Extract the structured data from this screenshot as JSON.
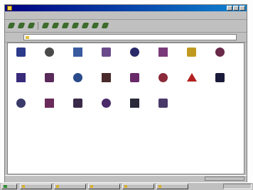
{
  "window": {
    "title": "",
    "icon": "folder-icon"
  },
  "menubar": {
    "items": [
      "",
      "",
      "",
      "",
      "",
      ""
    ]
  },
  "toolbar": {
    "buttons": [
      "back-icon",
      "forward-icon",
      "up-icon",
      "cut-icon",
      "copy-icon",
      "paste-icon",
      "undo-icon",
      "delete-icon",
      "properties-icon",
      "views-icon"
    ]
  },
  "address": {
    "label": "",
    "value": ""
  },
  "content": {
    "items": [
      {
        "name": "accessibility-icon",
        "label": "",
        "color": "#2b3a8a"
      },
      {
        "name": "add-hardware-icon",
        "label": "",
        "color": "#4a4a4a"
      },
      {
        "name": "add-remove-programs-icon",
        "label": "",
        "color": "#3a5aa0"
      },
      {
        "name": "date-time-icon",
        "label": "",
        "color": "#6a4a8a"
      },
      {
        "name": "display-icon",
        "label": "",
        "color": "#2a2a6a"
      },
      {
        "name": "find-fast-icon",
        "label": "",
        "color": "#7a3a7a"
      },
      {
        "name": "fonts-icon",
        "label": "",
        "color": "#c09a20"
      },
      {
        "name": "game-controllers-icon",
        "label": "",
        "color": "#6a2a4a"
      },
      {
        "name": "internet-icon",
        "label": "",
        "color": "#3a2a7a"
      },
      {
        "name": "keyboard-icon",
        "label": "",
        "color": "#5a2a5a"
      },
      {
        "name": "mail-icon",
        "label": "",
        "color": "#2a4a8a"
      },
      {
        "name": "modems-icon",
        "label": "",
        "color": "#4a2a2a"
      },
      {
        "name": "mouse-icon",
        "label": "",
        "color": "#6a2a6a"
      },
      {
        "name": "multimedia-icon",
        "label": "",
        "color": "#8a2a3a"
      },
      {
        "name": "network-icon",
        "label": "",
        "color": "#b22020"
      },
      {
        "name": "passwords-icon",
        "label": "",
        "color": "#1a1a3a"
      },
      {
        "name": "power-icon",
        "label": "",
        "color": "#3a3a6a"
      },
      {
        "name": "printers-icon",
        "label": "",
        "color": "#6a2a5a"
      },
      {
        "name": "regional-settings-icon",
        "label": "",
        "color": "#3a2a4a"
      },
      {
        "name": "sounds-icon",
        "label": "",
        "color": "#4a2a6a"
      },
      {
        "name": "system-icon",
        "label": "",
        "color": "#2a2a3a"
      },
      {
        "name": "users-icon",
        "label": "",
        "color": "#4a3a6a"
      }
    ]
  },
  "statusbar": {
    "text": ""
  },
  "taskbar": {
    "start_icon": "windows-logo-icon",
    "tasks": [
      "",
      "",
      "",
      "",
      ""
    ]
  }
}
